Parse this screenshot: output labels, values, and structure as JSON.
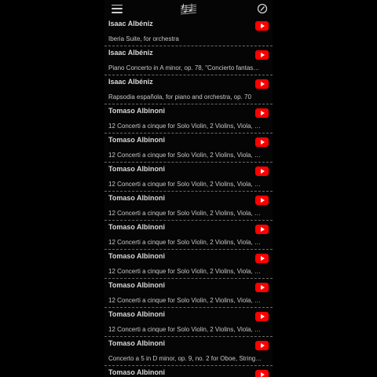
{
  "app": {
    "colors": {
      "background": "#000000",
      "text_primary": "#d8d8d8",
      "text_secondary": "#c8c8c8",
      "separator": "#6a6a6a",
      "youtube_red": "#ff0000"
    },
    "icons": {
      "menu": "hamburger-menu-icon",
      "logo": "music-staff-icon",
      "edit": "edit-circle-icon",
      "play": "youtube-play-icon"
    }
  },
  "items": [
    {
      "composer": "Isaac Albéniz",
      "work": "Iberia Suite, for orchestra"
    },
    {
      "composer": "Isaac Albéniz",
      "work": "Piano Concerto in A minor, op. 78, \"Concierto fantas…"
    },
    {
      "composer": "Isaac Albéniz",
      "work": "Rapsodia española, for piano and orchestra, op. 70"
    },
    {
      "composer": "Tomaso Albinoni",
      "work": "12 Concerti a cinque for Solo Violin, 2 Violins, Viola, …"
    },
    {
      "composer": "Tomaso Albinoni",
      "work": "12 Concerti a cinque for Solo Violin, 2 Violins, Viola, …"
    },
    {
      "composer": "Tomaso Albinoni",
      "work": "12 Concerti a cinque for Solo Violin, 2 Violins, Viola, …"
    },
    {
      "composer": "Tomaso Albinoni",
      "work": "12 Concerti a cinque for Solo Violin, 2 Violins, Viola, …"
    },
    {
      "composer": "Tomaso Albinoni",
      "work": "12 Concerti a cinque for Solo Violin, 2 Violins, Viola, …"
    },
    {
      "composer": "Tomaso Albinoni",
      "work": "12 Concerti a cinque for Solo Violin, 2 Violins, Viola, …"
    },
    {
      "composer": "Tomaso Albinoni",
      "work": "12 Concerti a cinque for Solo Violin, 2 Violins, Viola, …"
    },
    {
      "composer": "Tomaso Albinoni",
      "work": "12 Concerti a cinque for Solo Violin, 2 Violins, Viola, …"
    },
    {
      "composer": "Tomaso Albinoni",
      "work": "Concerto a 5 in D minor, op. 9, no. 2 for Oboe, String…"
    },
    {
      "composer": "Tomaso Albinoni",
      "work": ""
    }
  ]
}
